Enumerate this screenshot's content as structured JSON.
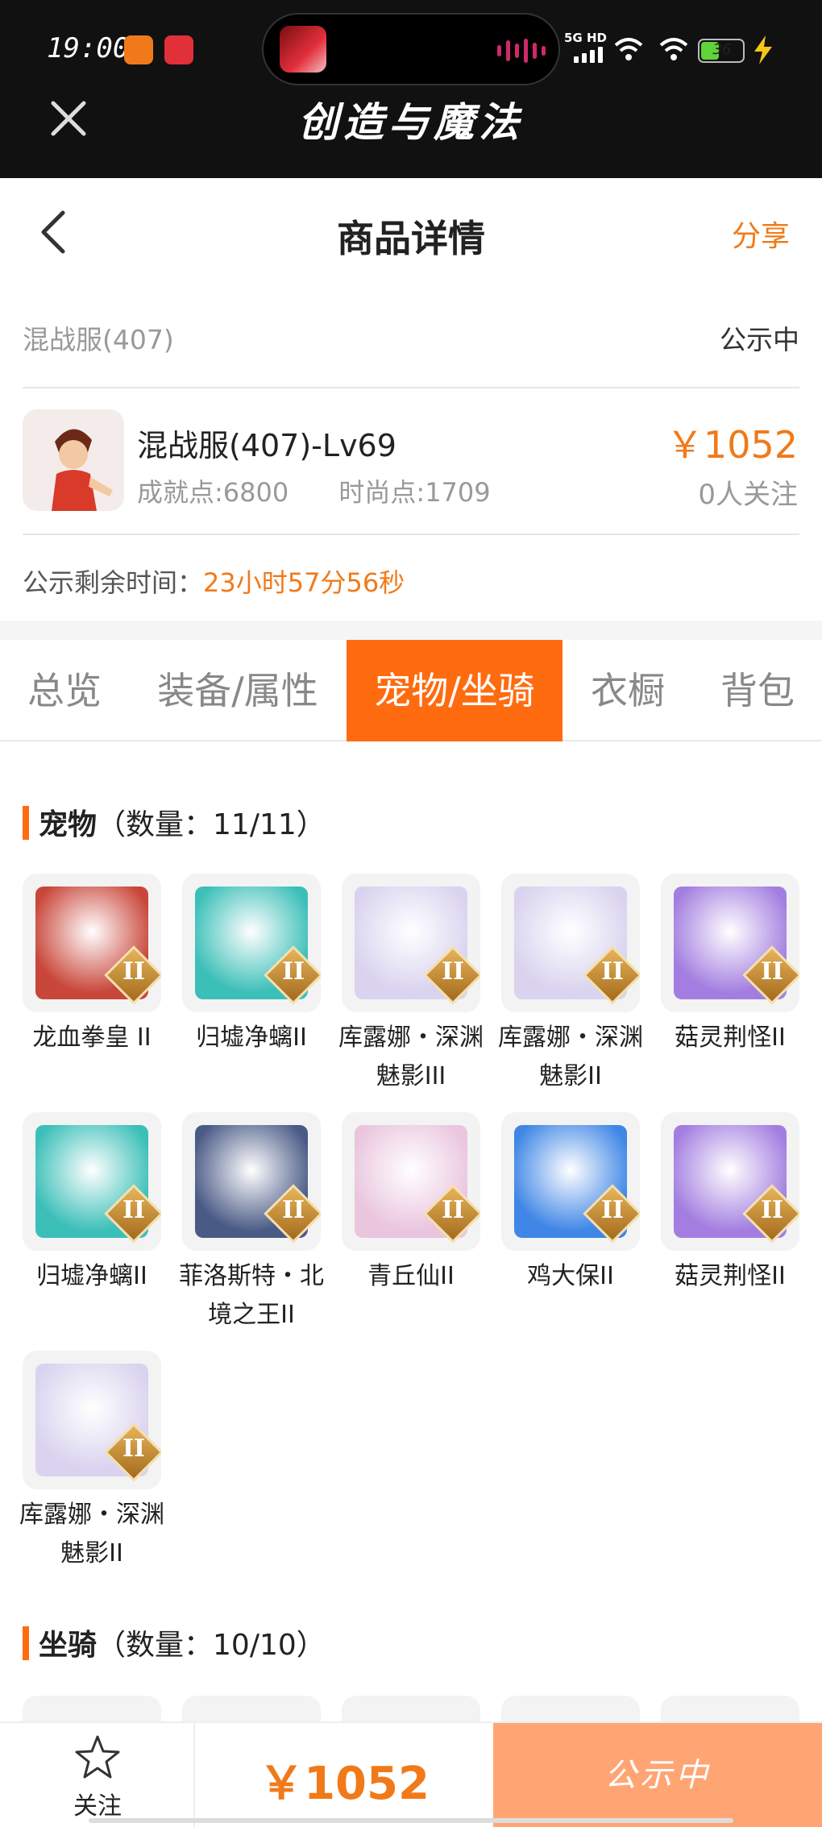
{
  "status_bar": {
    "time": "19:00",
    "network": "5G HD",
    "battery": "36"
  },
  "app_bar": {
    "title": "创造与魔法"
  },
  "header": {
    "title": "商品详情",
    "share": "分享"
  },
  "listing": {
    "server": "混战服(407)",
    "status": "公示中",
    "character_name": "混战服(407)-Lv69",
    "achievement": "成就点:6800",
    "fashion": "时尚点:1709",
    "price": "￥1052",
    "followers": "0人关注",
    "remaining_label": "公示剩余时间：",
    "remaining_value": "23小时57分56秒"
  },
  "tabs": [
    {
      "label": "总览"
    },
    {
      "label": "装备/属性"
    },
    {
      "label": "宠物/坐骑"
    },
    {
      "label": "衣橱"
    },
    {
      "label": "背包"
    }
  ],
  "active_tab": "宠物/坐骑",
  "pets_section": {
    "title": "宠物",
    "count": "（数量：11/11）"
  },
  "pets": [
    {
      "name": "龙血拳皇 II",
      "color": "#c9463a"
    },
    {
      "name": "归墟净螭II",
      "color": "#3bbfb8"
    },
    {
      "name": "库露娜・深渊魅影III",
      "color": "#d9d3ef"
    },
    {
      "name": "库露娜・深渊魅影II",
      "color": "#d9d3ef"
    },
    {
      "name": "菇灵荆怪II",
      "color": "#a37ee0"
    },
    {
      "name": "归墟净螭II",
      "color": "#3bbfb8"
    },
    {
      "name": "菲洛斯特・北境之王II",
      "color": "#4a5a86"
    },
    {
      "name": "青丘仙II",
      "color": "#eac5de"
    },
    {
      "name": "鸡大保II",
      "color": "#3f86e6"
    },
    {
      "name": "菇灵荆怪II",
      "color": "#a37ee0"
    },
    {
      "name": "库露娜・深渊魅影II",
      "color": "#d9d3ef"
    }
  ],
  "mounts_section": {
    "title": "坐骑",
    "count": "（数量：10/10）"
  },
  "badge": "II",
  "bottom": {
    "follow": "关注",
    "price": "￥1052",
    "cta": "公示中"
  },
  "colors": {
    "accent": "#ff6b0f",
    "price": "#f07a1a",
    "cta": "#ffa574"
  }
}
